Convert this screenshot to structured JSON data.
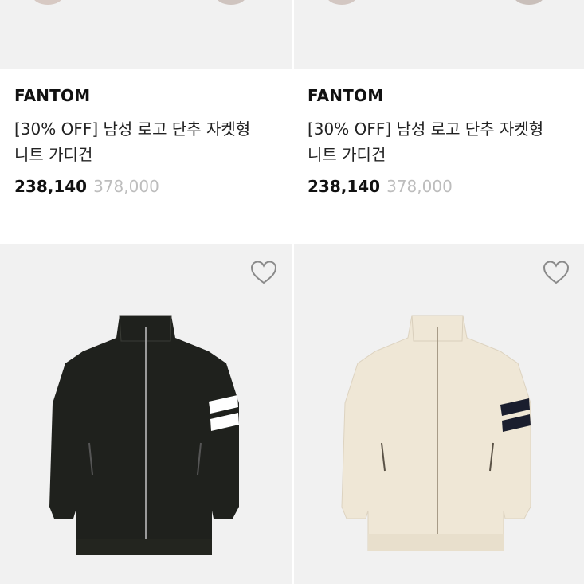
{
  "products": [
    {
      "brand": "FANTOM",
      "title_line1": "[30% OFF] 남성 로고 단추 자켓형",
      "title_line2": "니트 가디건",
      "price": "238,140",
      "original_price": "378,000"
    },
    {
      "brand": "FANTOM",
      "title_line1": "[30% OFF] 남성 로고 단추 자켓형",
      "title_line2": "니트 가디건",
      "price": "238,140",
      "original_price": "378,000"
    },
    {
      "jacket_color": "#1f211d",
      "stripe_color": "#ffffff",
      "heart_icon": "heart-outline-icon"
    },
    {
      "jacket_color": "#efe7d6",
      "stripe_color": "#1a1e2e",
      "heart_icon": "heart-outline-icon"
    }
  ],
  "colors": {
    "image_bg": "#f1f1f1",
    "original_price": "#bdbdbd"
  }
}
